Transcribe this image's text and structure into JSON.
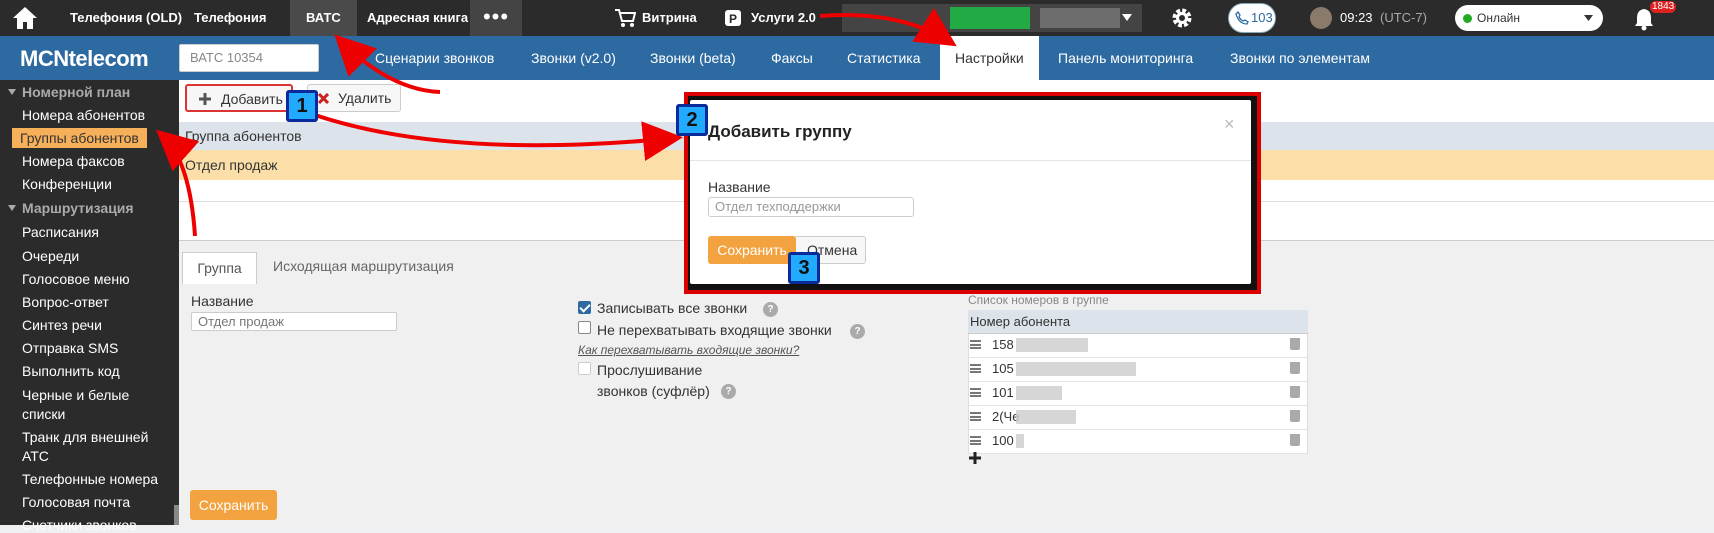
{
  "topbar": {
    "tabs": [
      "Телефония (OLD)",
      "Телефония",
      "ВАТС",
      "Адресная книга"
    ],
    "active_tab": "ВАТС",
    "more_label": "•••",
    "vitrina_label": "Витрина",
    "services_label": "Услуги 2.0",
    "calls_count": "103",
    "time": "09:23",
    "timezone": "(UTC-7)",
    "status_label": "Онлайн",
    "notif_count": "1843"
  },
  "brand": {
    "logo": "MCNtelecom"
  },
  "vatc_select": {
    "value": "ВАТС 10354"
  },
  "main_tabs": [
    {
      "label": "Сценарии звонков"
    },
    {
      "label": "Звонки (v2.0)"
    },
    {
      "label": "Звонки (beta)"
    },
    {
      "label": "Факсы"
    },
    {
      "label": "Статистика"
    },
    {
      "label": "Настройки",
      "active": true
    },
    {
      "label": "Панель мониторинга"
    },
    {
      "label": "Звонки по элементам"
    }
  ],
  "sidebar": {
    "sections": [
      {
        "title": "Номерной план",
        "items": [
          "Номера абонентов",
          "Группы абонентов",
          "Номера факсов",
          "Конференции"
        ]
      },
      {
        "title": "Маршрутизация",
        "items": [
          "Расписания",
          "Очереди",
          "Голосовое меню",
          "Вопрос-ответ",
          "Синтез речи",
          "Отправка SMS",
          "Выполнить код",
          "Черные и белые списки",
          "Транк для внешней АТС",
          "Телефонные номера",
          "Голосовая почта",
          "Счетчики звонков"
        ]
      }
    ],
    "active_item": "Группы абонентов"
  },
  "toolbar": {
    "add_label": "Добавить",
    "delete_label": "Удалить"
  },
  "groups_table": {
    "header": "Группа абонентов",
    "rows": [
      "Отдел продаж"
    ]
  },
  "detail": {
    "tabs": [
      "Группа",
      "Исходящая маршрутизация"
    ],
    "name_label": "Название",
    "name_value": "Отдел продаж",
    "record_all_label": "Записывать все звонки",
    "no_intercept_label": "Не перехватывать входящие звонки",
    "intercept_link": "Как перехватывать входящие звонки?",
    "listen_label_1": "Прослушивание",
    "listen_label_2": "звонков (суфлёр)",
    "numbers_title": "Список номеров в группе",
    "numbers_header": "Номер абонента",
    "numbers": [
      "158",
      "105",
      "101",
      "2(Че",
      "100"
    ],
    "save_label": "Сохранить"
  },
  "modal": {
    "title": "Добавить группу",
    "close": "×",
    "name_label": "Название",
    "name_placeholder": "Отдел техподдержки",
    "save_label": "Сохранить",
    "cancel_label": "Отмена"
  },
  "callouts": [
    "1",
    "2",
    "3"
  ]
}
